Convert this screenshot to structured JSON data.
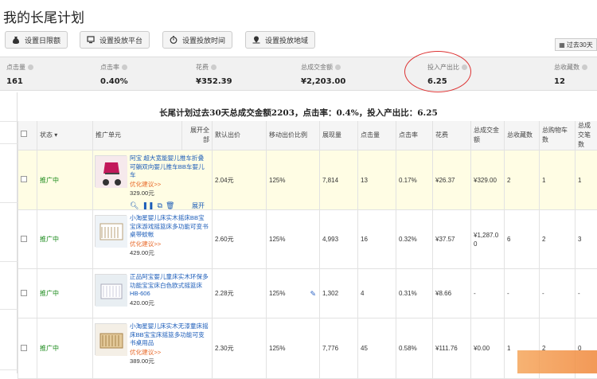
{
  "page_title": "我的长尾计划",
  "toolbar": {
    "daily_limit": "设置日限额",
    "platform": "设置投放平台",
    "time": "设置投放时间",
    "region": "设置投放地域",
    "range": "过去30天"
  },
  "stats": [
    {
      "label": "点击量",
      "value": "161"
    },
    {
      "label": "点击率",
      "value": "0.40%"
    },
    {
      "label": "花费",
      "value": "¥352.39"
    },
    {
      "label": "总成交金额",
      "value": "¥2,203.00"
    },
    {
      "label": "投入产出比",
      "value": "6.25"
    },
    {
      "label": "总收藏数",
      "value": "12"
    }
  ],
  "summary": "长尾计划过去30天总成交金额2203，点击率：0.4%，投入产出比：6.25",
  "table": {
    "headers": [
      "状态",
      "推广单元",
      "展开全部",
      "默认出价",
      "移动出价比例",
      "展现量",
      "点击量",
      "点击率",
      "花费",
      "总成交金额",
      "总收藏数",
      "总购物车数",
      "总成交笔数"
    ],
    "rows": [
      {
        "status": "推广中",
        "product": "阿宝 超大宽能婴儿推车折叠可躺双向婴儿推车BB车婴儿车",
        "suggest": "优化建议>>",
        "price": "329.00元",
        "expand": "展开",
        "bid": "2.04元",
        "mobile": "125%",
        "impr": "7,814",
        "clicks": "13",
        "ctr": "0.17%",
        "cost": "¥26.37",
        "gmv": "¥329.00",
        "fav": "2",
        "cart": "1",
        "orders": "1"
      },
      {
        "status": "推广中",
        "product": "小淘星婴儿床实木摇床BB宝宝床游戏摇篮床多功能可变书桌带蚊帐",
        "suggest": "优化建议>>",
        "price": "429.00元",
        "bid": "2.60元",
        "mobile": "125%",
        "impr": "4,993",
        "clicks": "16",
        "ctr": "0.32%",
        "cost": "¥37.57",
        "gmv": "¥1,287.00",
        "fav": "6",
        "cart": "2",
        "orders": "3"
      },
      {
        "status": "推广中",
        "product": "正品阿宝婴儿童床实木环保多功能宝宝床白色欧式摇篮床HB-606",
        "suggest": "",
        "price": "420.00元",
        "bid": "2.28元",
        "mobile": "125%",
        "impr": "1,302",
        "clicks": "4",
        "ctr": "0.31%",
        "cost": "¥8.66",
        "gmv": "-",
        "fav": "-",
        "cart": "-",
        "orders": "-"
      },
      {
        "status": "推广中",
        "product": "小淘星婴儿床实木无漆童床摇床BB宝宝床摇篮多功能可变书桌用品",
        "suggest": "优化建议>>",
        "price": "389.00元",
        "bid": "2.30元",
        "mobile": "125%",
        "impr": "7,776",
        "clicks": "45",
        "ctr": "0.58%",
        "cost": "¥111.76",
        "gmv": "¥0.00",
        "fav": "1",
        "cart": "2",
        "orders": "0"
      }
    ]
  }
}
